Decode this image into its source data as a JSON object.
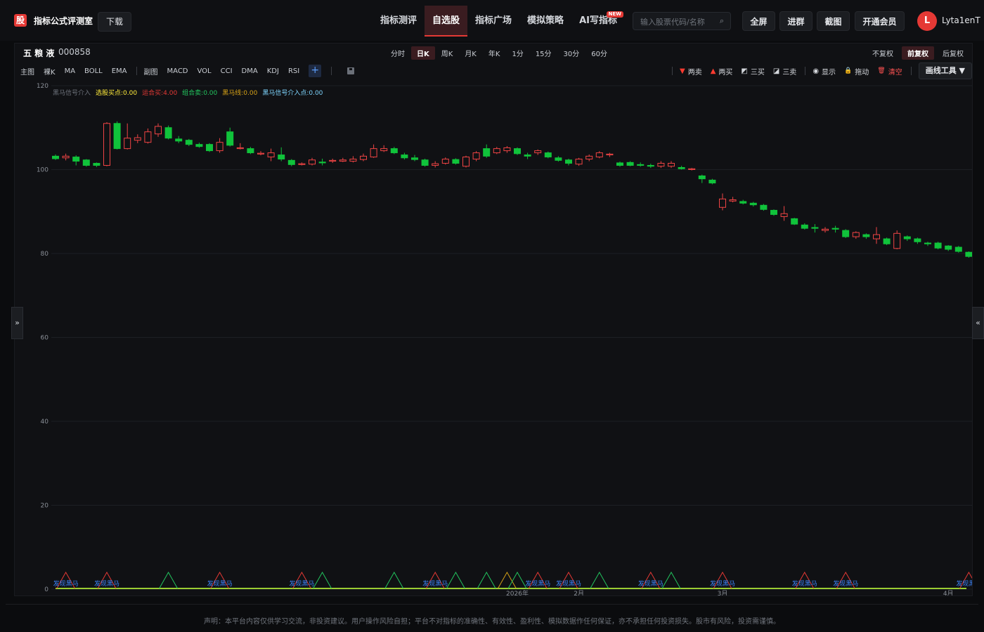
{
  "header": {
    "logo_text": "股",
    "brand_name": "指标公式评测室",
    "download_label": "下载",
    "nav": [
      {
        "label": "指标测评",
        "active": false
      },
      {
        "label": "自选股",
        "active": true
      },
      {
        "label": "指标广场",
        "active": false
      },
      {
        "label": "模拟策略",
        "active": false
      },
      {
        "label": "AI写指标",
        "active": false,
        "badge": "NEW"
      }
    ],
    "search_placeholder": "输入股票代码/名称",
    "fullscreen_label": "全屏",
    "join_group_label": "进群",
    "screenshot_label": "截图",
    "vip_label": "开通会员",
    "avatar_initial": "L",
    "username": "Lyta1enT"
  },
  "stock": {
    "name": "五 粮 液",
    "code": "000858"
  },
  "period_tabs": [
    {
      "label": "分时",
      "active": false
    },
    {
      "label": "日K",
      "active": true
    },
    {
      "label": "周K",
      "active": false
    },
    {
      "label": "月K",
      "active": false
    },
    {
      "label": "年K",
      "active": false
    },
    {
      "label": "1分",
      "active": false
    },
    {
      "label": "15分",
      "active": false
    },
    {
      "label": "30分",
      "active": false
    },
    {
      "label": "60分",
      "active": false
    }
  ],
  "adjust_tabs": [
    {
      "label": "不复权",
      "active": false
    },
    {
      "label": "前复权",
      "active": true
    },
    {
      "label": "后复权",
      "active": false
    }
  ],
  "indicators_main": [
    "主图",
    "裸K",
    "MA",
    "BOLL",
    "EMA"
  ],
  "indicators_sub": [
    "副图",
    "MACD",
    "VOL",
    "CCI",
    "DMA",
    "KDJ",
    "RSI"
  ],
  "draw_tools": [
    {
      "icon": "▼",
      "label": "两卖",
      "icon_color": "#ff3b30"
    },
    {
      "icon": "▲",
      "label": "两买",
      "icon_color": "#ff3b30"
    },
    {
      "icon": "◩",
      "label": "三买",
      "icon_color": "#e5e7eb"
    },
    {
      "icon": "◪",
      "label": "三卖",
      "icon_color": "#e5e7eb"
    },
    {
      "icon": "◉",
      "label": "显示",
      "icon_color": "#e5e7eb"
    },
    {
      "icon": "🔒",
      "label": "拖动",
      "icon_color": "#e5c76b"
    },
    {
      "icon": "🗑",
      "label": "清空",
      "icon_color": "#ff5252"
    }
  ],
  "draw_button_label": "画线工具 ▼",
  "legend": [
    {
      "text": "黑马信号介入",
      "color": "#6b7079"
    },
    {
      "text": "选股买点:0.00",
      "color": "#ffeb3b"
    },
    {
      "text": "运合买:4.00",
      "color": "#e53935"
    },
    {
      "text": "组合卖:0.00",
      "color": "#22c55e"
    },
    {
      "text": "黑马线:0.00",
      "color": "#d4a017"
    },
    {
      "text": "黑马信号介入点:0.00",
      "color": "#7dd3fc"
    }
  ],
  "signal_label": "发现黑马",
  "side_toggle_left": "»",
  "side_toggle_right": "«",
  "disclaimer": "声明：本平台内容仅供学习交流，非投资建议。用户操作风险自担；平台不对指标的准确性、有效性、盈利性、模拟数据作任何保证，亦不承担任何投资损失。股市有风险，投资需谨慎。",
  "chart_data": {
    "type": "candlestick",
    "y_ticks": [
      0,
      20,
      40,
      60,
      80,
      100,
      120
    ],
    "ylim": [
      0,
      120
    ],
    "x_labels": [
      "2026年",
      "2月",
      "3月",
      "4月"
    ],
    "up_color": "#ef4444",
    "down_color": "#10c33b",
    "candles": [
      [
        103.2,
        102.6,
        103.6,
        102.3
      ],
      [
        102.8,
        103.2,
        103.8,
        102.2
      ],
      [
        103.0,
        102.0,
        103.4,
        101.0
      ],
      [
        102.3,
        101.0,
        102.5,
        100.7
      ],
      [
        101.5,
        101.0,
        101.7,
        100.6
      ],
      [
        101.0,
        111.0,
        111.3,
        100.8
      ],
      [
        111.0,
        105.0,
        111.5,
        104.8
      ],
      [
        105.0,
        107.5,
        111.0,
        104.8
      ],
      [
        107.0,
        107.6,
        108.4,
        106.3
      ],
      [
        106.5,
        109.0,
        109.8,
        106.2
      ],
      [
        108.5,
        110.3,
        111.0,
        107.8
      ],
      [
        110.0,
        107.5,
        110.5,
        107.2
      ],
      [
        107.3,
        106.8,
        108.0,
        106.3
      ],
      [
        107.0,
        106.0,
        107.3,
        105.6
      ],
      [
        106.0,
        105.5,
        106.4,
        105.2
      ],
      [
        106.0,
        104.5,
        106.3,
        104.2
      ],
      [
        104.5,
        106.5,
        107.5,
        104.0
      ],
      [
        109.0,
        105.8,
        110.0,
        105.5
      ],
      [
        105.0,
        105.2,
        106.3,
        104.8
      ],
      [
        105.0,
        104.0,
        105.4,
        103.7
      ],
      [
        103.9,
        103.9,
        104.4,
        103.4
      ],
      [
        103.0,
        104.0,
        105.0,
        102.0
      ],
      [
        103.5,
        102.5,
        105.3,
        102.0
      ],
      [
        102.2,
        101.2,
        102.5,
        100.8
      ],
      [
        101.2,
        101.4,
        101.7,
        101.0
      ],
      [
        101.3,
        102.3,
        102.8,
        101.0
      ],
      [
        101.8,
        101.6,
        102.6,
        101.0
      ],
      [
        102.0,
        102.2,
        102.6,
        101.6
      ],
      [
        102.0,
        102.3,
        102.8,
        101.8
      ],
      [
        102.0,
        102.5,
        103.2,
        101.7
      ],
      [
        102.4,
        103.2,
        103.8,
        102.0
      ],
      [
        103.0,
        105.0,
        106.0,
        102.8
      ],
      [
        104.5,
        105.0,
        105.8,
        104.2
      ],
      [
        105.0,
        104.0,
        105.4,
        103.7
      ],
      [
        103.5,
        102.8,
        104.0,
        102.4
      ],
      [
        102.8,
        102.4,
        103.5,
        102.0
      ],
      [
        102.3,
        101.0,
        102.6,
        100.7
      ],
      [
        101.0,
        101.4,
        102.0,
        100.5
      ],
      [
        101.5,
        102.5,
        102.9,
        101.2
      ],
      [
        102.4,
        101.5,
        102.7,
        101.2
      ],
      [
        100.8,
        103.0,
        103.3,
        100.5
      ],
      [
        102.5,
        104.0,
        104.4,
        102.0
      ],
      [
        105.0,
        103.2,
        106.0,
        102.8
      ],
      [
        104.0,
        105.0,
        105.4,
        103.7
      ],
      [
        104.5,
        105.2,
        105.6,
        104.0
      ],
      [
        105.0,
        103.8,
        105.3,
        103.5
      ],
      [
        103.5,
        103.2,
        104.0,
        102.5
      ],
      [
        104.0,
        104.5,
        104.8,
        103.5
      ],
      [
        104.0,
        103.0,
        104.3,
        102.7
      ],
      [
        102.8,
        102.2,
        103.2,
        101.9
      ],
      [
        102.3,
        101.5,
        102.6,
        101.0
      ],
      [
        101.3,
        102.5,
        102.8,
        100.9
      ],
      [
        102.5,
        103.2,
        103.6,
        102.0
      ],
      [
        103.0,
        104.0,
        104.4,
        102.7
      ],
      [
        103.5,
        103.7,
        104.0,
        103.0
      ],
      [
        101.6,
        101.0,
        101.9,
        100.7
      ],
      [
        101.7,
        101.0,
        102.0,
        100.8
      ],
      [
        101.2,
        101.0,
        101.7,
        100.7
      ],
      [
        101.0,
        100.8,
        101.4,
        100.4
      ],
      [
        100.8,
        101.5,
        102.0,
        100.4
      ],
      [
        100.8,
        101.5,
        102.0,
        100.4
      ],
      [
        100.5,
        100.2,
        100.9,
        100.0
      ],
      [
        100.0,
        100.2,
        100.4,
        99.8
      ],
      [
        98.5,
        97.8,
        98.8,
        96.8
      ],
      [
        97.5,
        96.8,
        97.8,
        96.5
      ],
      [
        91.0,
        93.0,
        94.3,
        90.3
      ],
      [
        92.5,
        92.8,
        93.5,
        92.2
      ],
      [
        92.4,
        92.0,
        92.8,
        91.7
      ],
      [
        92.0,
        91.6,
        92.3,
        91.2
      ],
      [
        91.5,
        90.5,
        91.8,
        90.2
      ],
      [
        90.3,
        89.3,
        90.5,
        89.0
      ],
      [
        88.8,
        89.5,
        91.3,
        87.8
      ],
      [
        88.3,
        87.0,
        88.5,
        86.8
      ],
      [
        86.8,
        86.0,
        87.2,
        85.7
      ],
      [
        86.2,
        86.0,
        87.0,
        85.0
      ],
      [
        85.5,
        85.8,
        86.3,
        85.0
      ],
      [
        86.0,
        85.8,
        86.6,
        85.0
      ],
      [
        85.5,
        84.0,
        85.8,
        83.7
      ],
      [
        84.0,
        85.0,
        85.3,
        83.5
      ],
      [
        84.5,
        84.0,
        84.8,
        83.5
      ],
      [
        83.5,
        84.5,
        86.3,
        82.3
      ],
      [
        83.5,
        82.3,
        83.8,
        82.0
      ],
      [
        81.2,
        84.8,
        85.5,
        81.0
      ],
      [
        84.0,
        83.5,
        84.3,
        83.0
      ],
      [
        83.5,
        82.8,
        83.8,
        82.3
      ],
      [
        82.5,
        82.3,
        82.8,
        81.8
      ],
      [
        82.5,
        81.3,
        82.8,
        81.0
      ],
      [
        81.8,
        81.0,
        82.0,
        80.6
      ],
      [
        81.5,
        80.5,
        81.8,
        80.2
      ],
      [
        80.3,
        79.3,
        80.5,
        79.0
      ],
      [
        79.0,
        79.5,
        79.8,
        78.7
      ]
    ],
    "signal_triangles": [
      {
        "i": 1,
        "color": "#e53935",
        "label": true
      },
      {
        "i": 5,
        "color": "#e53935",
        "label": true
      },
      {
        "i": 11,
        "color": "#22c55e",
        "label": false
      },
      {
        "i": 16,
        "color": "#e53935",
        "label": true
      },
      {
        "i": 24,
        "color": "#e53935",
        "label": true
      },
      {
        "i": 26,
        "color": "#22c55e",
        "label": false
      },
      {
        "i": 33,
        "color": "#22c55e",
        "label": false
      },
      {
        "i": 37,
        "color": "#e53935",
        "label": true
      },
      {
        "i": 39,
        "color": "#22c55e",
        "label": false
      },
      {
        "i": 42,
        "color": "#22c55e",
        "label": false
      },
      {
        "i": 44,
        "color": "#d4a017",
        "label": false
      },
      {
        "i": 45,
        "color": "#22c55e",
        "label": false
      },
      {
        "i": 47,
        "color": "#e53935",
        "label": true
      },
      {
        "i": 50,
        "color": "#e53935",
        "label": true
      },
      {
        "i": 53,
        "color": "#22c55e",
        "label": false
      },
      {
        "i": 58,
        "color": "#e53935",
        "label": true
      },
      {
        "i": 60,
        "color": "#22c55e",
        "label": false
      },
      {
        "i": 65,
        "color": "#e53935",
        "label": true
      },
      {
        "i": 73,
        "color": "#e53935",
        "label": true
      },
      {
        "i": 77,
        "color": "#e53935",
        "label": true
      },
      {
        "i": 89,
        "color": "#e53935",
        "label": true
      }
    ]
  }
}
